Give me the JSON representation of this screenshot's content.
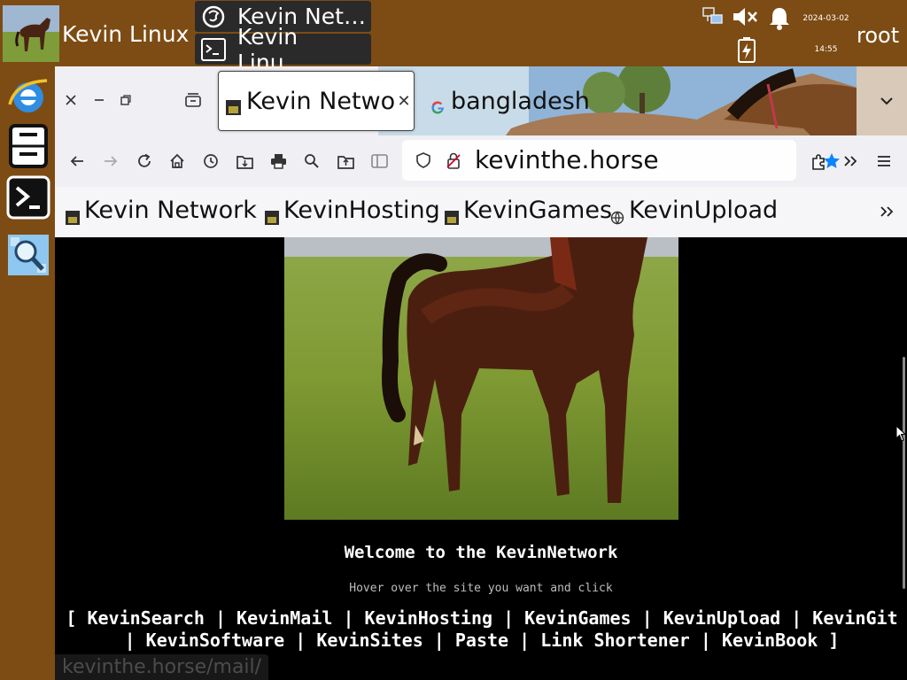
{
  "panel": {
    "title": "Kevin Linux",
    "tasks": [
      {
        "label": "Kevin Net…",
        "icon": "firefox-icon"
      },
      {
        "label": "Kevin Linu…",
        "icon": "terminal-icon"
      }
    ],
    "clock": {
      "date": "2024-03-02",
      "time": "14:55"
    },
    "user": "root",
    "tray": [
      "network-icon",
      "volume-muted-icon",
      "bell-icon",
      "battery-charging-icon"
    ]
  },
  "dock": [
    "internet-explorer-icon",
    "file-cabinet-icon",
    "terminal-icon",
    "magnifier-icon"
  ],
  "browser": {
    "tabs": [
      {
        "title": "Kevin Netwo",
        "active": true
      },
      {
        "title": "bangladesh",
        "active": false
      }
    ],
    "url": "kevinthe.horse",
    "bookmarks": [
      "Kevin Network",
      "KevinHosting",
      "KevinGames",
      "KevinUpload"
    ]
  },
  "page": {
    "welcome": "Welcome to the KevinNetwork",
    "hint": "Hover over the site you want and click",
    "links": [
      "KevinSearch",
      "KevinMail",
      "KevinHosting",
      "KevinGames",
      "KevinUpload",
      "KevinGit",
      "KevinSoftware",
      "KevinSites",
      "Paste",
      "Link Shortener",
      "KevinBook"
    ],
    "status_url": "kevinthe.horse/mail/"
  },
  "colors": {
    "panel": "#7d4c14",
    "page_bg": "#000000",
    "accent": "#0a84ff"
  }
}
